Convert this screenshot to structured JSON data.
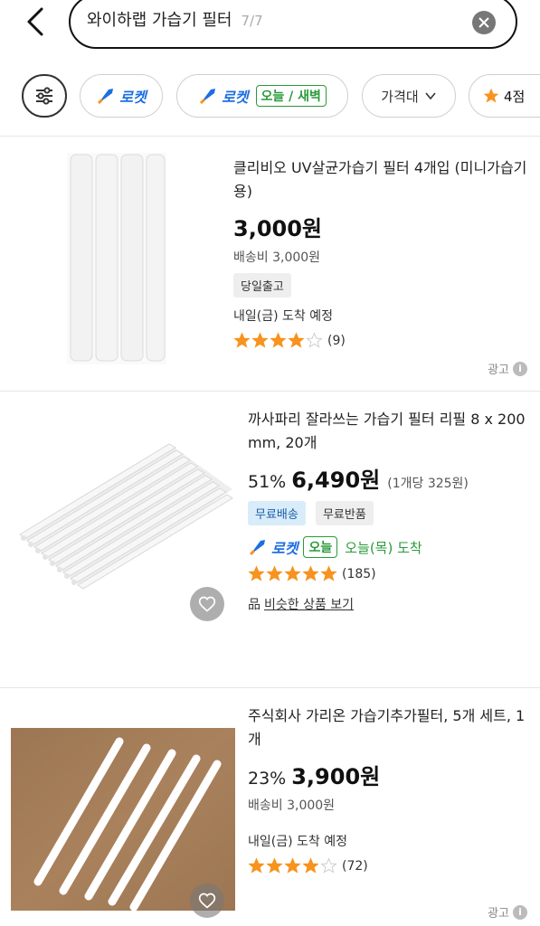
{
  "header": {
    "search_query": "와이하랩 가습기 필터",
    "counter": "7/7"
  },
  "filters": {
    "rocket_label": "로켓",
    "rocket2_label": "로켓",
    "rocket2_badge": "오늘 / 새벽",
    "price_label": "가격대",
    "rating_label": "4점"
  },
  "products": [
    {
      "title": "클리비오 UV살균가습기 필터 4개입 (미니가습기용)",
      "discount": "",
      "price": "3,000원",
      "unit_price": "",
      "shipping": "배송비 3,000원",
      "tags": [
        "당일출고"
      ],
      "arrival": "내일(금) 도착 예정",
      "rating": 4,
      "review_count": "(9)",
      "ad_label": "광고"
    },
    {
      "title": "까사파리 잘라쓰는 가습기 필터 리필 8 x 200 mm, 20개",
      "discount": "51%",
      "price": "6,490원",
      "unit_price": "(1개당 325원)",
      "tags": [
        "무료배송",
        "무료반품"
      ],
      "rocket_label": "로켓",
      "rocket_badge": "오늘",
      "arrival": "오늘(목) 도착",
      "rating": 5,
      "review_count": "(185)",
      "similar_icon": "品",
      "similar_label": "비슷한 상품 보기"
    },
    {
      "title": "주식회사 가리온 가습기추가필터, 5개 세트, 1개",
      "discount": "23%",
      "price": "3,900원",
      "shipping": "배송비 3,000원",
      "arrival": "내일(금) 도착 예정",
      "rating": 4,
      "review_count": "(72)",
      "ad_label": "광고"
    }
  ],
  "colors": {
    "rocket_blue": "#1d6fe0",
    "today_green": "#2a9a3a",
    "star_orange": "#f7931e"
  }
}
